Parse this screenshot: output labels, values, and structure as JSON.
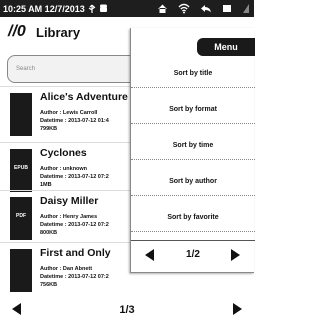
{
  "status": {
    "text": "10:25 AM 12/7/2013"
  },
  "app": {
    "title": "Library",
    "logo": "//0"
  },
  "search": {
    "placeholder": "Search"
  },
  "books": [
    {
      "title": "Alice's Adventure",
      "author": "Author : Lewis Carroll",
      "datetime": "Datetime : 2013-07-12 01:4",
      "size": "799KB",
      "cover": ""
    },
    {
      "title": "Cyclones",
      "author": "Author : unknown",
      "datetime": "Datetime : 2013-07-12 07:2",
      "size": "1MB",
      "cover": "EPUB"
    },
    {
      "title": "Daisy Miller",
      "author": "Author : Henry James",
      "datetime": "Datetime : 2013-07-12 07:2",
      "size": "800KB",
      "cover": "PDF"
    },
    {
      "title": "First and Only",
      "author": "Author : Dan Abnett",
      "datetime": "Datetime : 2013-07-12 07:2",
      "size": "756KB",
      "cover": ""
    }
  ],
  "footer": {
    "page": "1/3"
  },
  "menu": {
    "title": "Menu",
    "items": [
      "Sort by title",
      "Sort by format",
      "Sort by time",
      "Sort by author",
      "Sort by favorite"
    ],
    "page": "1/2"
  }
}
